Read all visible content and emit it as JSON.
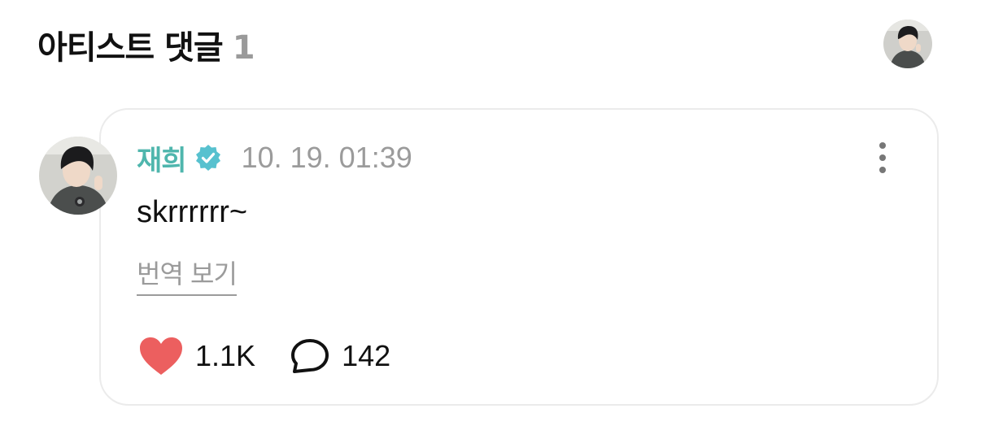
{
  "header": {
    "title": "아티스트 댓글",
    "count": "1",
    "avatar_icon": "artist-avatar-icon"
  },
  "comment": {
    "author": "재희",
    "verified_icon": "verified-badge-icon",
    "timestamp": "10. 19. 01:39",
    "text": "skrrrrrr~",
    "translate_label": "번역 보기",
    "more_icon": "more-vertical-icon",
    "likes": "1.1K",
    "replies": "142"
  },
  "colors": {
    "accent": "#4fb6ad",
    "verified": "#57c1cf",
    "heart": "#ec5f5f",
    "muted": "#9b9b9b"
  }
}
